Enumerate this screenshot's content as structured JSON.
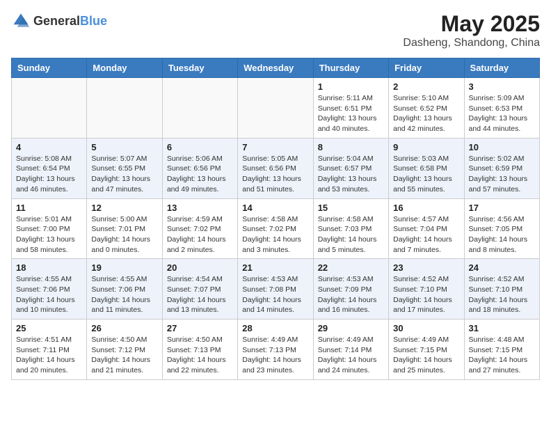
{
  "header": {
    "logo_general": "General",
    "logo_blue": "Blue",
    "month_year": "May 2025",
    "location": "Dasheng, Shandong, China"
  },
  "weekdays": [
    "Sunday",
    "Monday",
    "Tuesday",
    "Wednesday",
    "Thursday",
    "Friday",
    "Saturday"
  ],
  "weeks": [
    [
      {
        "day": "",
        "sunrise": "",
        "sunset": "",
        "daylight": ""
      },
      {
        "day": "",
        "sunrise": "",
        "sunset": "",
        "daylight": ""
      },
      {
        "day": "",
        "sunrise": "",
        "sunset": "",
        "daylight": ""
      },
      {
        "day": "",
        "sunrise": "",
        "sunset": "",
        "daylight": ""
      },
      {
        "day": "1",
        "sunrise": "Sunrise: 5:11 AM",
        "sunset": "Sunset: 6:51 PM",
        "daylight": "Daylight: 13 hours and 40 minutes."
      },
      {
        "day": "2",
        "sunrise": "Sunrise: 5:10 AM",
        "sunset": "Sunset: 6:52 PM",
        "daylight": "Daylight: 13 hours and 42 minutes."
      },
      {
        "day": "3",
        "sunrise": "Sunrise: 5:09 AM",
        "sunset": "Sunset: 6:53 PM",
        "daylight": "Daylight: 13 hours and 44 minutes."
      }
    ],
    [
      {
        "day": "4",
        "sunrise": "Sunrise: 5:08 AM",
        "sunset": "Sunset: 6:54 PM",
        "daylight": "Daylight: 13 hours and 46 minutes."
      },
      {
        "day": "5",
        "sunrise": "Sunrise: 5:07 AM",
        "sunset": "Sunset: 6:55 PM",
        "daylight": "Daylight: 13 hours and 47 minutes."
      },
      {
        "day": "6",
        "sunrise": "Sunrise: 5:06 AM",
        "sunset": "Sunset: 6:56 PM",
        "daylight": "Daylight: 13 hours and 49 minutes."
      },
      {
        "day": "7",
        "sunrise": "Sunrise: 5:05 AM",
        "sunset": "Sunset: 6:56 PM",
        "daylight": "Daylight: 13 hours and 51 minutes."
      },
      {
        "day": "8",
        "sunrise": "Sunrise: 5:04 AM",
        "sunset": "Sunset: 6:57 PM",
        "daylight": "Daylight: 13 hours and 53 minutes."
      },
      {
        "day": "9",
        "sunrise": "Sunrise: 5:03 AM",
        "sunset": "Sunset: 6:58 PM",
        "daylight": "Daylight: 13 hours and 55 minutes."
      },
      {
        "day": "10",
        "sunrise": "Sunrise: 5:02 AM",
        "sunset": "Sunset: 6:59 PM",
        "daylight": "Daylight: 13 hours and 57 minutes."
      }
    ],
    [
      {
        "day": "11",
        "sunrise": "Sunrise: 5:01 AM",
        "sunset": "Sunset: 7:00 PM",
        "daylight": "Daylight: 13 hours and 58 minutes."
      },
      {
        "day": "12",
        "sunrise": "Sunrise: 5:00 AM",
        "sunset": "Sunset: 7:01 PM",
        "daylight": "Daylight: 14 hours and 0 minutes."
      },
      {
        "day": "13",
        "sunrise": "Sunrise: 4:59 AM",
        "sunset": "Sunset: 7:02 PM",
        "daylight": "Daylight: 14 hours and 2 minutes."
      },
      {
        "day": "14",
        "sunrise": "Sunrise: 4:58 AM",
        "sunset": "Sunset: 7:02 PM",
        "daylight": "Daylight: 14 hours and 3 minutes."
      },
      {
        "day": "15",
        "sunrise": "Sunrise: 4:58 AM",
        "sunset": "Sunset: 7:03 PM",
        "daylight": "Daylight: 14 hours and 5 minutes."
      },
      {
        "day": "16",
        "sunrise": "Sunrise: 4:57 AM",
        "sunset": "Sunset: 7:04 PM",
        "daylight": "Daylight: 14 hours and 7 minutes."
      },
      {
        "day": "17",
        "sunrise": "Sunrise: 4:56 AM",
        "sunset": "Sunset: 7:05 PM",
        "daylight": "Daylight: 14 hours and 8 minutes."
      }
    ],
    [
      {
        "day": "18",
        "sunrise": "Sunrise: 4:55 AM",
        "sunset": "Sunset: 7:06 PM",
        "daylight": "Daylight: 14 hours and 10 minutes."
      },
      {
        "day": "19",
        "sunrise": "Sunrise: 4:55 AM",
        "sunset": "Sunset: 7:06 PM",
        "daylight": "Daylight: 14 hours and 11 minutes."
      },
      {
        "day": "20",
        "sunrise": "Sunrise: 4:54 AM",
        "sunset": "Sunset: 7:07 PM",
        "daylight": "Daylight: 14 hours and 13 minutes."
      },
      {
        "day": "21",
        "sunrise": "Sunrise: 4:53 AM",
        "sunset": "Sunset: 7:08 PM",
        "daylight": "Daylight: 14 hours and 14 minutes."
      },
      {
        "day": "22",
        "sunrise": "Sunrise: 4:53 AM",
        "sunset": "Sunset: 7:09 PM",
        "daylight": "Daylight: 14 hours and 16 minutes."
      },
      {
        "day": "23",
        "sunrise": "Sunrise: 4:52 AM",
        "sunset": "Sunset: 7:10 PM",
        "daylight": "Daylight: 14 hours and 17 minutes."
      },
      {
        "day": "24",
        "sunrise": "Sunrise: 4:52 AM",
        "sunset": "Sunset: 7:10 PM",
        "daylight": "Daylight: 14 hours and 18 minutes."
      }
    ],
    [
      {
        "day": "25",
        "sunrise": "Sunrise: 4:51 AM",
        "sunset": "Sunset: 7:11 PM",
        "daylight": "Daylight: 14 hours and 20 minutes."
      },
      {
        "day": "26",
        "sunrise": "Sunrise: 4:50 AM",
        "sunset": "Sunset: 7:12 PM",
        "daylight": "Daylight: 14 hours and 21 minutes."
      },
      {
        "day": "27",
        "sunrise": "Sunrise: 4:50 AM",
        "sunset": "Sunset: 7:13 PM",
        "daylight": "Daylight: 14 hours and 22 minutes."
      },
      {
        "day": "28",
        "sunrise": "Sunrise: 4:49 AM",
        "sunset": "Sunset: 7:13 PM",
        "daylight": "Daylight: 14 hours and 23 minutes."
      },
      {
        "day": "29",
        "sunrise": "Sunrise: 4:49 AM",
        "sunset": "Sunset: 7:14 PM",
        "daylight": "Daylight: 14 hours and 24 minutes."
      },
      {
        "day": "30",
        "sunrise": "Sunrise: 4:49 AM",
        "sunset": "Sunset: 7:15 PM",
        "daylight": "Daylight: 14 hours and 25 minutes."
      },
      {
        "day": "31",
        "sunrise": "Sunrise: 4:48 AM",
        "sunset": "Sunset: 7:15 PM",
        "daylight": "Daylight: 14 hours and 27 minutes."
      }
    ]
  ]
}
